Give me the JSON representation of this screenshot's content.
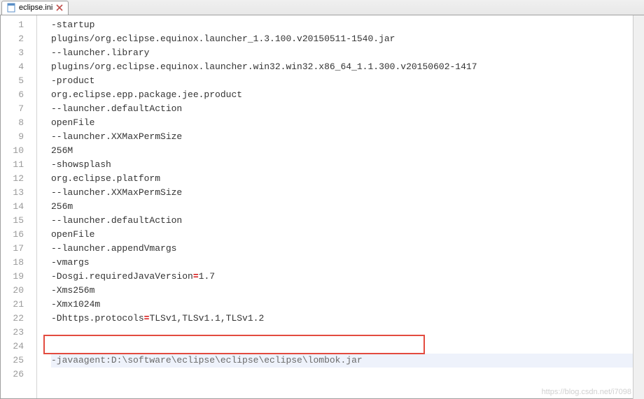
{
  "tab": {
    "label": "eclipse.ini"
  },
  "lines": [
    {
      "n": 1,
      "segs": [
        {
          "t": "-startup"
        }
      ]
    },
    {
      "n": 2,
      "segs": [
        {
          "t": "plugins/org.eclipse.equinox.launcher_1.3.100.v20150511-1540.jar"
        }
      ]
    },
    {
      "n": 3,
      "segs": [
        {
          "t": "--launcher.library"
        }
      ]
    },
    {
      "n": 4,
      "segs": [
        {
          "t": "plugins/org.eclipse.equinox.launcher.win32.win32.x86_64_1.1.300.v20150602-1417"
        }
      ]
    },
    {
      "n": 5,
      "segs": [
        {
          "t": "-product"
        }
      ]
    },
    {
      "n": 6,
      "segs": [
        {
          "t": "org.eclipse.epp.package.jee.product"
        }
      ]
    },
    {
      "n": 7,
      "segs": [
        {
          "t": "--launcher.defaultAction"
        }
      ]
    },
    {
      "n": 8,
      "segs": [
        {
          "t": "openFile"
        }
      ]
    },
    {
      "n": 9,
      "segs": [
        {
          "t": "--launcher.XXMaxPermSize"
        }
      ]
    },
    {
      "n": 10,
      "segs": [
        {
          "t": "256M"
        }
      ]
    },
    {
      "n": 11,
      "segs": [
        {
          "t": "-showsplash"
        }
      ]
    },
    {
      "n": 12,
      "segs": [
        {
          "t": "org.eclipse.platform"
        }
      ]
    },
    {
      "n": 13,
      "segs": [
        {
          "t": "--launcher.XXMaxPermSize"
        }
      ]
    },
    {
      "n": 14,
      "segs": [
        {
          "t": "256m"
        }
      ]
    },
    {
      "n": 15,
      "segs": [
        {
          "t": "--launcher.defaultAction"
        }
      ]
    },
    {
      "n": 16,
      "segs": [
        {
          "t": "openFile"
        }
      ]
    },
    {
      "n": 17,
      "segs": [
        {
          "t": "--launcher.appendVmargs"
        }
      ]
    },
    {
      "n": 18,
      "segs": [
        {
          "t": "-vmargs"
        }
      ]
    },
    {
      "n": 19,
      "segs": [
        {
          "t": "-Dosgi.requiredJavaVersion"
        },
        {
          "t": "=",
          "cls": "eq"
        },
        {
          "t": "1.7"
        }
      ]
    },
    {
      "n": 20,
      "segs": [
        {
          "t": "-Xms256m"
        }
      ]
    },
    {
      "n": 21,
      "segs": [
        {
          "t": "-Xmx1024m"
        }
      ]
    },
    {
      "n": 22,
      "segs": [
        {
          "t": "-Dhttps.protocols"
        },
        {
          "t": "=",
          "cls": "eq"
        },
        {
          "t": "TLSv1,TLSv1.1,TLSv1.2"
        }
      ]
    },
    {
      "n": 23,
      "segs": [
        {
          "t": ""
        }
      ]
    },
    {
      "n": 24,
      "segs": [
        {
          "t": ""
        }
      ]
    },
    {
      "n": 25,
      "segs": [
        {
          "t": "-javaagent:D:\\software\\eclipse\\eclipse\\eclipse\\lombok.jar",
          "cls": "txt"
        }
      ],
      "hl": true
    },
    {
      "n": 26,
      "segs": [
        {
          "t": ""
        }
      ]
    }
  ],
  "watermark": "https://blog.csdn.net/i7098"
}
